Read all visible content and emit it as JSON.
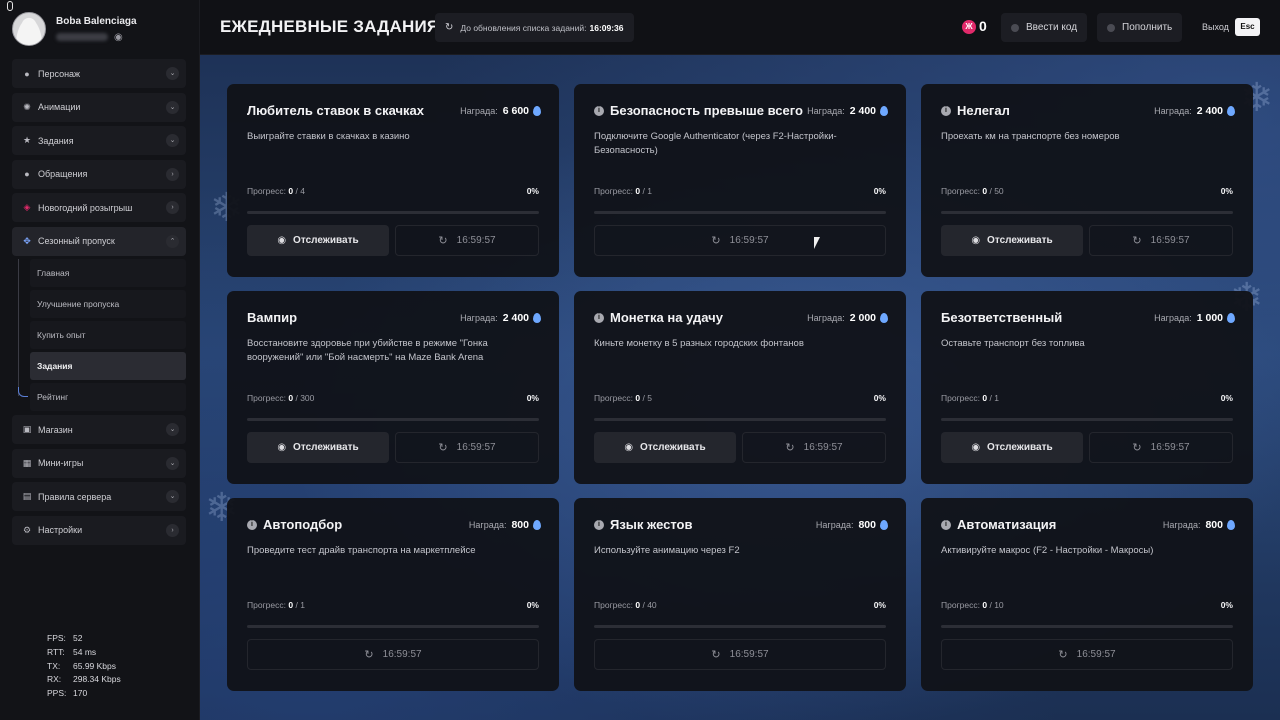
{
  "sidebar": {
    "profile": {
      "name": "Boba Balenciaga"
    },
    "nav": [
      {
        "label": "Персонаж",
        "icon": "user-icon",
        "chev": "⌄"
      },
      {
        "label": "Анимации",
        "icon": "animation-icon",
        "chev": "⌄"
      },
      {
        "label": "Задания",
        "icon": "star-icon",
        "chev": "⌄"
      },
      {
        "label": "Обращения",
        "icon": "chat-icon",
        "chev": "›"
      },
      {
        "label": "Новогодний розыгрыш",
        "icon": "ticket-icon",
        "chev": "›"
      },
      {
        "label": "Сезонный пропуск",
        "icon": "pass-icon",
        "chev": "⌃"
      }
    ],
    "sub": [
      {
        "label": "Главная"
      },
      {
        "label": "Улучшение пропуска"
      },
      {
        "label": "Купить опыт"
      },
      {
        "label": "Задания"
      },
      {
        "label": "Рейтинг"
      }
    ],
    "nav_bottom": [
      {
        "label": "Магазин",
        "icon": "shop-icon",
        "chev": "⌄"
      },
      {
        "label": "Мини-игры",
        "icon": "games-icon",
        "chev": "⌄"
      },
      {
        "label": "Правила сервера",
        "icon": "rules-icon",
        "chev": "⌄"
      },
      {
        "label": "Настройки",
        "icon": "gear-icon",
        "chev": "›"
      }
    ],
    "stats": [
      {
        "k": "FPS:",
        "v": "52"
      },
      {
        "k": "RTT:",
        "v": "54 ms"
      },
      {
        "k": "TX:",
        "v": "65.99 Kbps"
      },
      {
        "k": "RX:",
        "v": "298.34 Kbps"
      },
      {
        "k": "PPS:",
        "v": "170"
      }
    ]
  },
  "header": {
    "title": "ЕЖЕДНЕВНЫЕ ЗАДАНИЯ",
    "timer_label": "До обновления списка заданий:",
    "timer_value": "16:09:36",
    "coin_symbol": "Ж",
    "coins": "0",
    "enter_code": "Ввести код",
    "top_up": "Пополнить",
    "exit": "Выход",
    "esc": "Esc"
  },
  "labels": {
    "reward": "Награда:",
    "progress": "Прогресс:",
    "track": "Отслеживать"
  },
  "tasks": [
    {
      "title": "Любитель ставок в скачках",
      "info": false,
      "reward": "6 600",
      "desc": "Выиграйте ставки в скачках в казино",
      "done": "0",
      "total": "/ 4",
      "percent": "0%",
      "progress": 0,
      "trackable": true,
      "timer": "16:59:57"
    },
    {
      "title": "Безопасность превыше всего",
      "info": true,
      "reward": "2 400",
      "desc": "Подключите Google Authenticator (через F2-Настройки-Безопасность)",
      "done": "0",
      "total": "/ 1",
      "percent": "0%",
      "progress": 0,
      "trackable": false,
      "timer": "16:59:57"
    },
    {
      "title": "Нелегал",
      "info": true,
      "reward": "2 400",
      "desc": "Проехать км на транспорте без номеров",
      "done": "0",
      "total": "/ 50",
      "percent": "0%",
      "progress": 0,
      "trackable": true,
      "timer": "16:59:57"
    },
    {
      "title": "Вампир",
      "info": false,
      "reward": "2 400",
      "desc": "Восстановите здоровье при убийстве в режиме \"Гонка вооружений\" или \"Бой насмерть\" на Maze Bank Arena",
      "done": "0",
      "total": "/ 300",
      "percent": "0%",
      "progress": 0,
      "trackable": true,
      "timer": "16:59:57"
    },
    {
      "title": "Монетка на удачу",
      "info": true,
      "reward": "2 000",
      "desc": "Киньте монетку в 5 разных городских фонтанов",
      "done": "0",
      "total": "/ 5",
      "percent": "0%",
      "progress": 0,
      "trackable": true,
      "timer": "16:59:57"
    },
    {
      "title": "Безответственный",
      "info": false,
      "reward": "1 000",
      "desc": "Оставьте транспорт без топлива",
      "done": "0",
      "total": "/ 1",
      "percent": "0%",
      "progress": 0,
      "trackable": true,
      "timer": "16:59:57"
    },
    {
      "title": "Автоподбор",
      "info": true,
      "reward": "800",
      "desc": "Проведите тест драйв транспорта на маркетплейсе",
      "done": "0",
      "total": "/ 1",
      "percent": "0%",
      "progress": 0,
      "trackable": false,
      "timer": "16:59:57"
    },
    {
      "title": "Язык жестов",
      "info": true,
      "reward": "800",
      "desc": "Используйте анимацию через F2",
      "done": "0",
      "total": "/ 40",
      "percent": "0%",
      "progress": 0,
      "trackable": false,
      "timer": "16:59:57"
    },
    {
      "title": "Автоматизация",
      "info": true,
      "reward": "800",
      "desc": "Активируйте макрос (F2 - Настройки - Макросы)",
      "done": "0",
      "total": "/ 10",
      "percent": "0%",
      "progress": 0,
      "trackable": false,
      "timer": "16:59:57"
    }
  ],
  "colors": {
    "accent": "#6ea8ff",
    "coin": "#e12a6a",
    "card_bg": "#111319"
  }
}
